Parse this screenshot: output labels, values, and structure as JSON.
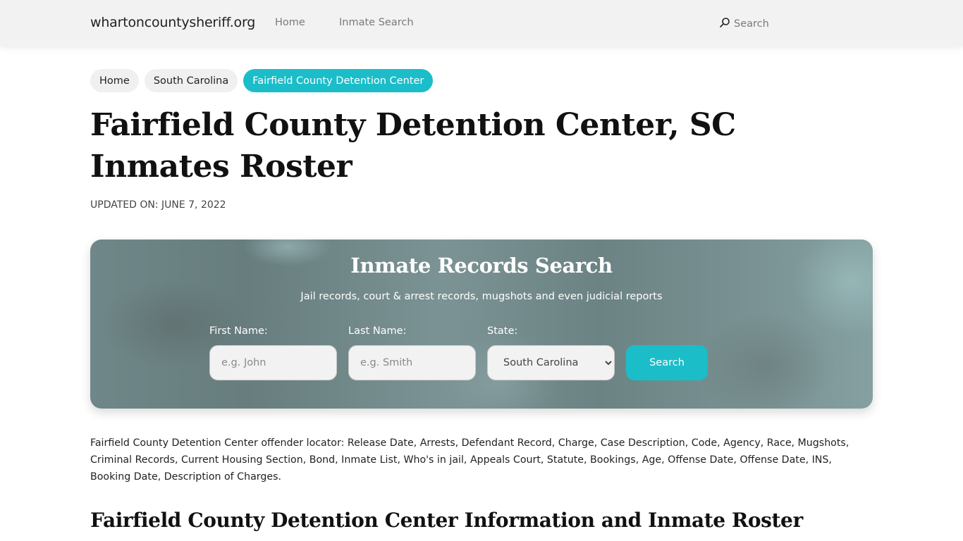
{
  "header": {
    "brand": "whartoncountysheriff.org",
    "nav": [
      {
        "label": "Home"
      },
      {
        "label": "Inmate Search"
      }
    ],
    "search_label": "Search",
    "search_icon": "search-icon"
  },
  "breadcrumb": [
    {
      "label": "Home"
    },
    {
      "label": "South Carolina"
    },
    {
      "label": "Fairfield County Detention Center",
      "active": true
    }
  ],
  "page": {
    "title": "Fairfield County Detention Center, SC Inmates Roster",
    "updated": "UPDATED ON: JUNE 7, 2022"
  },
  "search_form": {
    "title": "Inmate Records Search",
    "subtitle": "Jail records, court & arrest records, mugshots and even judicial reports",
    "first_name": {
      "label": "First Name:",
      "placeholder": "e.g. John",
      "value": ""
    },
    "last_name": {
      "label": "Last Name:",
      "placeholder": "e.g. Smith",
      "value": ""
    },
    "state": {
      "label": "State:",
      "selected": "South Carolina"
    },
    "button_label": "Search"
  },
  "description": "Fairfield County Detention Center offender locator: Release Date, Arrests, Defendant Record, Charge, Case Description, Code, Agency, Race, Mugshots, Criminal Records, Current Housing Section, Bond, Inmate List, Who's in jail, Appeals Court, Statute, Bookings, Age, Offense Date, Offense Date, INS, Booking Date, Description of Charges.",
  "section_heading": "Fairfield County Detention Center Information and Inmate Roster",
  "colors": {
    "accent": "#1bbdc9",
    "header_bg": "#f2f2f2",
    "hero_bg": "#6f8788"
  }
}
